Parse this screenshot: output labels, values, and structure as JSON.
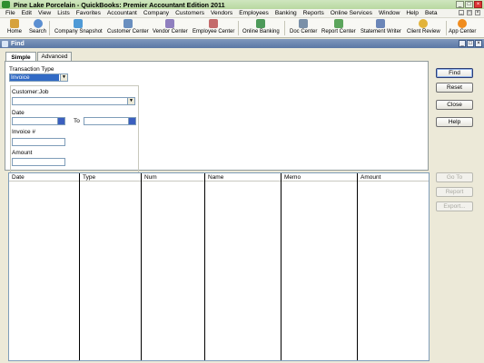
{
  "app": {
    "title": "Pine Lake Porcelain  - QuickBooks: Premier Accountant Edition 2011"
  },
  "menu": [
    "File",
    "Edit",
    "View",
    "Lists",
    "Favorites",
    "Accountant",
    "Company",
    "Customers",
    "Vendors",
    "Employees",
    "Banking",
    "Reports",
    "Online Services",
    "Window",
    "Help",
    "Beta"
  ],
  "toolbar": {
    "home": "Home",
    "search": "Search",
    "company_snapshot": "Company Snapshot",
    "customer_center": "Customer Center",
    "vendor_center": "Vendor Center",
    "employee_center": "Employee Center",
    "online_banking": "Online Banking",
    "doc_center": "Doc Center",
    "report_center": "Report Center",
    "statement_writer": "Statement Writer",
    "client_review": "Client Review",
    "app_center": "App Center"
  },
  "find": {
    "title": "Find",
    "tabs": {
      "simple": "Simple",
      "advanced": "Advanced"
    },
    "transaction_type_label": "Transaction Type",
    "transaction_type_value": "Invoice",
    "customer_job_label": "Customer:Job",
    "date_label": "Date",
    "to_label": "To",
    "invoice_label": "Invoice #",
    "amount_label": "Amount",
    "buttons": {
      "find": "Find",
      "reset": "Reset",
      "close": "Close",
      "help": "Help",
      "go_to": "Go To",
      "report": "Report",
      "export": "Export..."
    },
    "columns": [
      "Date",
      "Type",
      "Num",
      "Name",
      "Memo",
      "Amount"
    ]
  },
  "colors": {
    "selection": "#316ac5",
    "titlebar": "#5a77a4"
  }
}
